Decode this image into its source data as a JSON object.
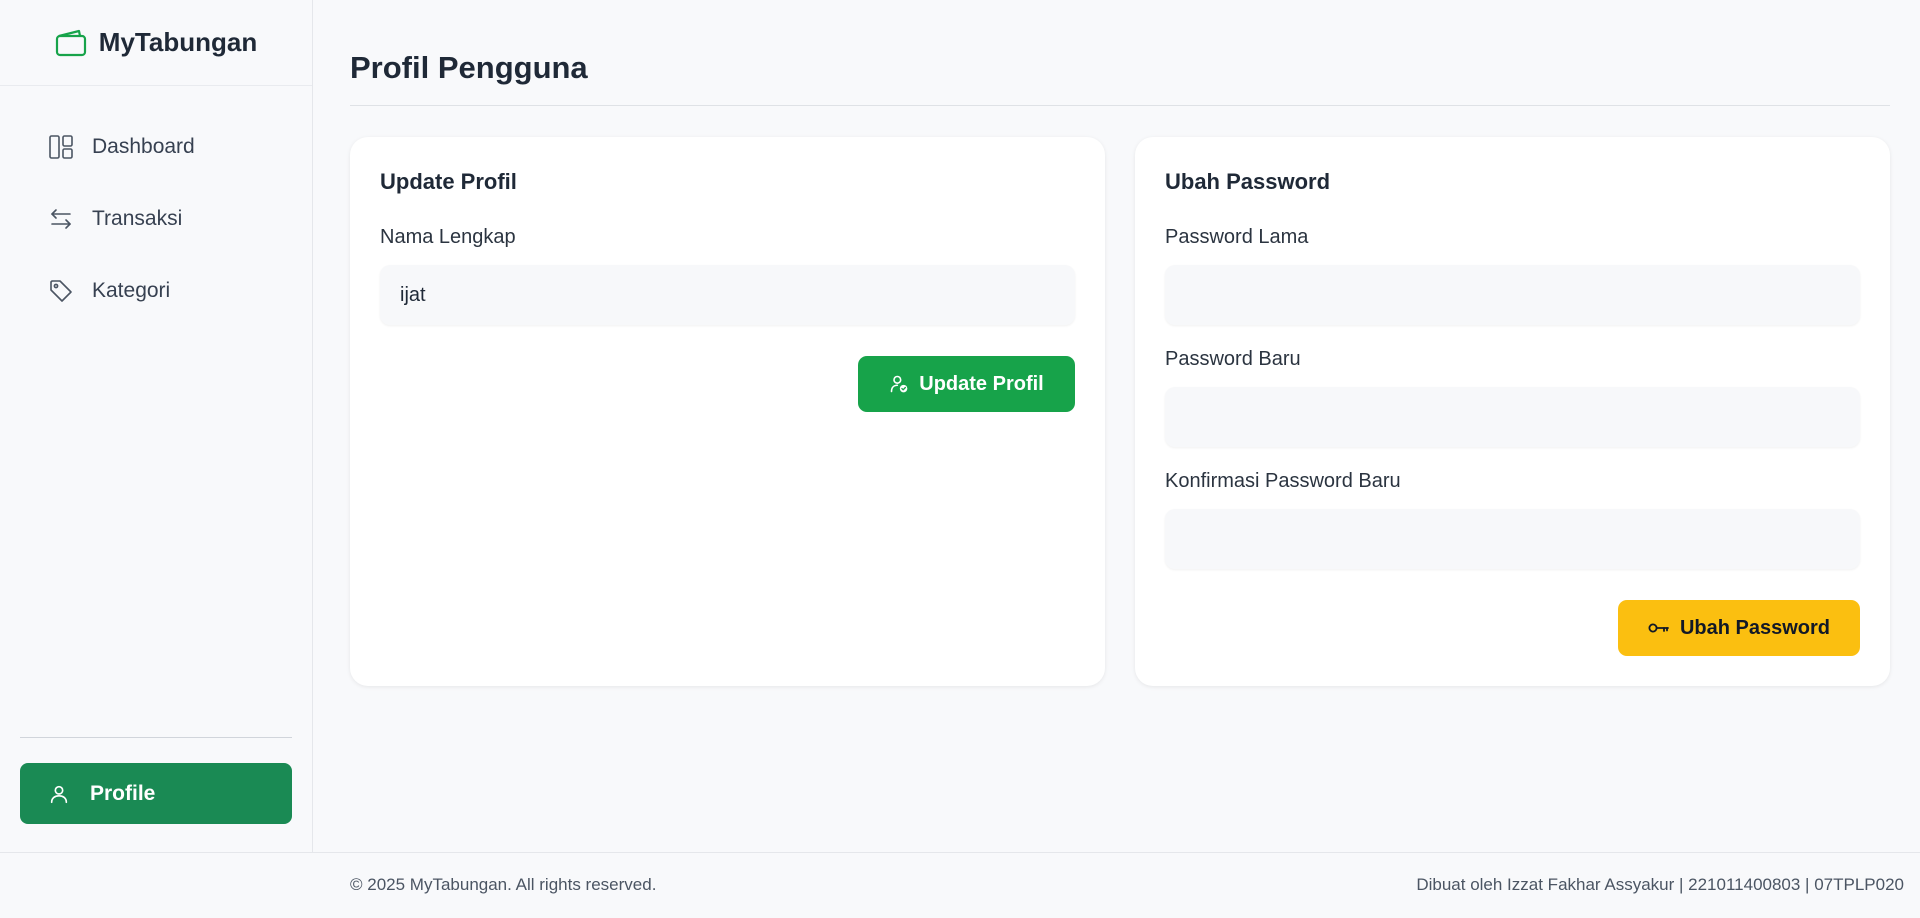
{
  "brand": {
    "name": "MyTabungan",
    "icon": "wallet-icon",
    "accent": "#17a34a"
  },
  "sidebar": {
    "items": [
      {
        "label": "Dashboard",
        "icon": "dashboard-icon"
      },
      {
        "label": "Transaksi",
        "icon": "transfer-arrows-icon"
      },
      {
        "label": "Kategori",
        "icon": "tag-icon"
      }
    ],
    "profile": {
      "label": "Profile",
      "icon": "user-icon",
      "color": "#1a8a54"
    }
  },
  "page": {
    "title": "Profil Pengguna"
  },
  "update_profile": {
    "title": "Update Profil",
    "name_label": "Nama Lengkap",
    "name_value": "ijat",
    "button_label": "Update Profil",
    "button_icon": "user-check-icon",
    "button_color": "#17a34a"
  },
  "change_password": {
    "title": "Ubah Password",
    "old_label": "Password Lama",
    "new_label": "Password Baru",
    "confirm_label": "Konfirmasi Password Baru",
    "button_label": "Ubah Password",
    "button_icon": "key-icon",
    "button_color": "#fbbf10"
  },
  "footer": {
    "copyright": "© 2025 MyTabungan. All rights reserved.",
    "credit": "Dibuat oleh Izzat Fakhar Assyakur | 221011400803 | 07TPLP020"
  }
}
